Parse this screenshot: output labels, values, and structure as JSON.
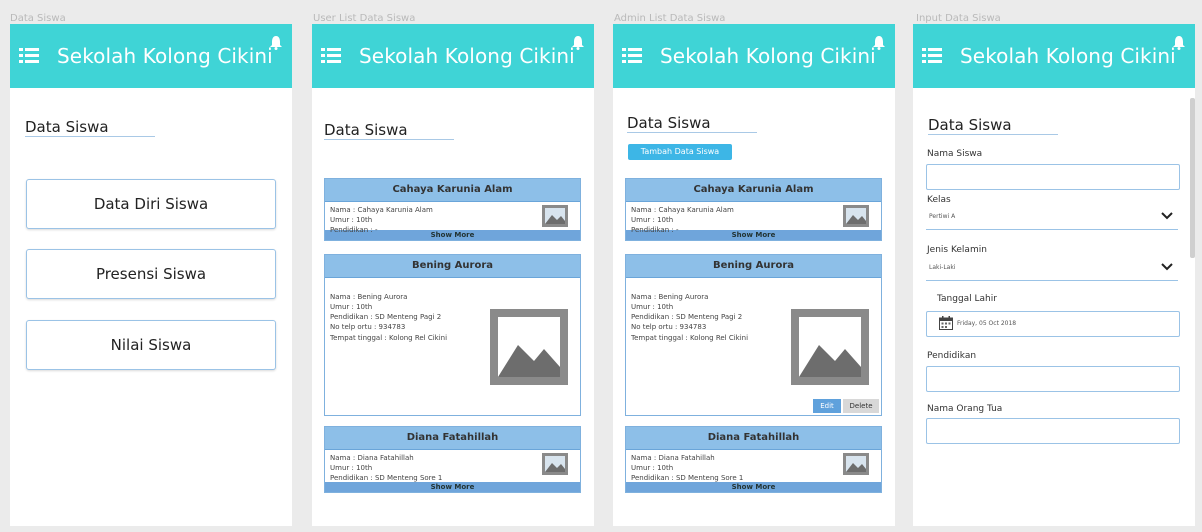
{
  "app": {
    "title": "Sekolah Kolong Cikini",
    "accent": "#3fd4d6",
    "menu_icon": "list-icon",
    "bell_icon": "bell-icon"
  },
  "frames": [
    {
      "caption": "Data Siswa"
    },
    {
      "caption": "User List Data Siswa"
    },
    {
      "caption": "Admin List Data Siswa"
    },
    {
      "caption": "Input Data Siswa"
    }
  ],
  "page_heading": "Data Siswa",
  "menu": {
    "buttons": [
      "Data Diri Siswa",
      "Presensi Siswa",
      "Nilai Siswa"
    ]
  },
  "students": [
    {
      "name": "Cahaya Karunia Alam",
      "lines": [
        "Nama : Cahaya Karunia Alam",
        "Umur : 10th",
        "Pendidikan : -"
      ]
    },
    {
      "name": "Bening Aurora",
      "lines": [
        "Nama : Bening Aurora",
        "Umur : 10th",
        "Pendidikan : SD Menteng Pagi 2",
        "No telp ortu : 934783",
        "Tempat tinggal : Kolong Rel Cikini"
      ]
    },
    {
      "name": "Diana Fatahillah",
      "lines": [
        "Nama : Diana Fatahillah",
        "Umur : 10th",
        "Pendidikan : SD Menteng Sore 1"
      ]
    }
  ],
  "show_more": "Show More",
  "admin": {
    "add_label": "Tambah Data Siswa",
    "edit_label": "Edit",
    "delete_label": "Delete"
  },
  "form": {
    "nama_label": "Nama Siswa",
    "kelas_label": "Kelas",
    "kelas_value": "Pertiwi A",
    "gender_label": "Jenis Kelamin",
    "gender_value": "Laki-Laki",
    "tanggal_label": "Tanggal Lahir",
    "tanggal_value": "Friday, 05 Oct 2018",
    "pendidikan_label": "Pendidikan",
    "ortu_label": "Nama Orang Tua"
  }
}
